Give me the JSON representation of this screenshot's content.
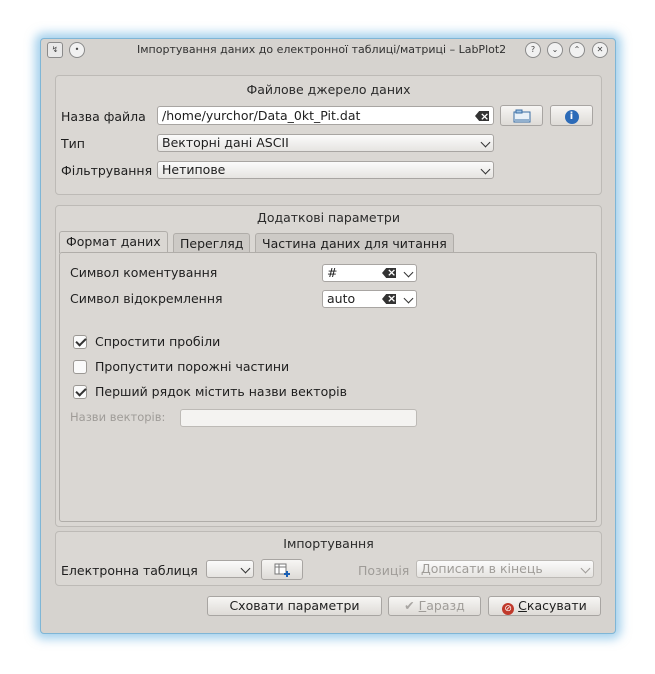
{
  "window": {
    "title": "Імпортування даних до електронної таблиці/матриці – LabPlot2",
    "help_glyph": "?"
  },
  "file_source": {
    "title": "Файлове джерело даних",
    "filename_label": "Назва файла",
    "filename_value": "/home/yurchor/Data_0kt_Pit.dat",
    "type_label": "Тип",
    "type_value": "Векторні дані ASCII",
    "filter_label": "Фільтрування",
    "filter_value": "Нетипове"
  },
  "extra": {
    "title": "Додаткові параметри",
    "tabs": [
      {
        "label": "Формат даних"
      },
      {
        "label": "Перегляд"
      },
      {
        "label": "Частина даних для читання"
      }
    ],
    "comment_label": "Символ коментування",
    "comment_value": "#",
    "separator_label": "Символ відокремлення",
    "separator_value": "auto",
    "checks": [
      {
        "label": "Спростити пробіли",
        "checked": true
      },
      {
        "label": "Пропустити порожні частини",
        "checked": false
      },
      {
        "label": "Перший рядок містить назви векторів",
        "checked": true
      }
    ],
    "vector_names_label": "Назви векторів:",
    "vector_names_value": ""
  },
  "import": {
    "title": "Імпортування",
    "spreadsheet_label": "Електронна таблиця",
    "position_label": "Позиція",
    "position_value": "Дописати в кінець"
  },
  "buttons": {
    "hide_options": "Сховати параметри",
    "ok_prefix": "",
    "ok_mnemonic": "Г",
    "ok_rest": "аразд",
    "cancel_mnemonic": "С",
    "cancel_rest": "касувати"
  }
}
